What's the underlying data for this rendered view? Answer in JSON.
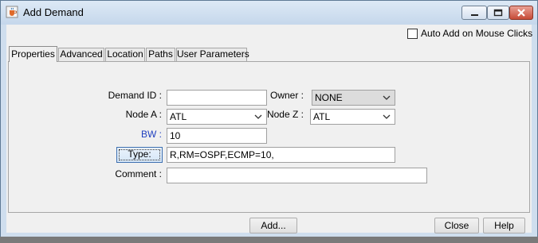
{
  "window": {
    "title": "Add Demand",
    "buttons": {
      "minimize": "minimize-icon",
      "maximize": "maximize-icon",
      "close": "close-icon"
    }
  },
  "auto_add": {
    "label": "Auto Add on Mouse Clicks",
    "checked": false
  },
  "tabs": [
    {
      "label": "Properties",
      "active": true
    },
    {
      "label": "Advanced"
    },
    {
      "label": "Location"
    },
    {
      "label": "Paths"
    },
    {
      "label": "User Parameters"
    }
  ],
  "form": {
    "demand_id": {
      "label": "Demand ID :",
      "value": ""
    },
    "owner": {
      "label": "Owner :",
      "value": "NONE"
    },
    "node_a": {
      "label": "Node A :",
      "value": "ATL"
    },
    "node_z": {
      "label": "Node Z :",
      "value": "ATL"
    },
    "bw": {
      "label": "BW :",
      "value": "10"
    },
    "type": {
      "button_label": "Type:",
      "value": "R,RM=OSPF,ECMP=10,"
    },
    "comment": {
      "label": "Comment :",
      "value": ""
    }
  },
  "footer": {
    "add_label": "Add...",
    "close_label": "Close",
    "help_label": "Help"
  },
  "colors": {
    "titlebar": "#cfdeee",
    "bw_label": "#1f3fbf",
    "close_button": "#c74b38"
  }
}
